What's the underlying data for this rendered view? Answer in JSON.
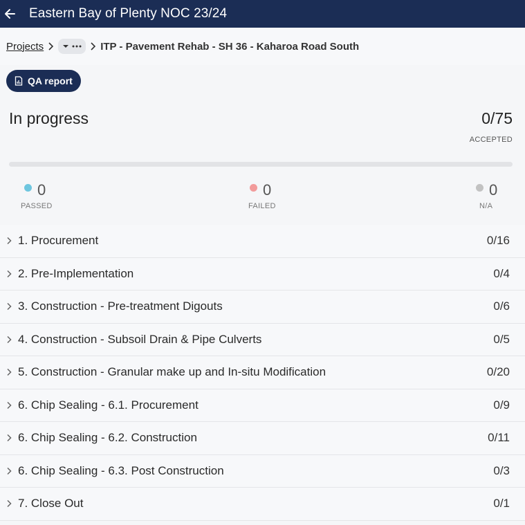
{
  "header": {
    "title": "Eastern Bay of Plenty NOC 23/24"
  },
  "breadcrumb": {
    "projects_label": "Projects",
    "current_label": "ITP - Pavement Rehab - SH 36 - Kaharoa Road South"
  },
  "qa_button": {
    "label": "QA report"
  },
  "summary": {
    "status": "In progress",
    "accepted_count": "0/75",
    "accepted_label": "ACCEPTED",
    "progress_fraction": 0,
    "passed": {
      "value": "0",
      "label": "PASSED",
      "color": "#6ec6df"
    },
    "failed": {
      "value": "0",
      "label": "FAILED",
      "color": "#f29b9b"
    },
    "na": {
      "value": "0",
      "label": "N/A",
      "color": "#c2c2c2"
    }
  },
  "sections": [
    {
      "name": "1. Procurement",
      "count": "0/16"
    },
    {
      "name": "2. Pre-Implementation",
      "count": "0/4"
    },
    {
      "name": "3. Construction - Pre-treatment Digouts",
      "count": "0/6"
    },
    {
      "name": "4. Construction - Subsoil Drain & Pipe Culverts",
      "count": "0/5"
    },
    {
      "name": "5. Construction - Granular make up and In-situ Modification",
      "count": "0/20"
    },
    {
      "name": "6. Chip Sealing - 6.1. Procurement",
      "count": "0/9"
    },
    {
      "name": "6. Chip Sealing - 6.2. Construction",
      "count": "0/11"
    },
    {
      "name": "6. Chip Sealing - 6.3. Post Construction",
      "count": "0/3"
    },
    {
      "name": "7. Close Out",
      "count": "0/1"
    }
  ],
  "colors": {
    "header_bg": "#1b2d55",
    "button_bg": "#1b2d55"
  }
}
